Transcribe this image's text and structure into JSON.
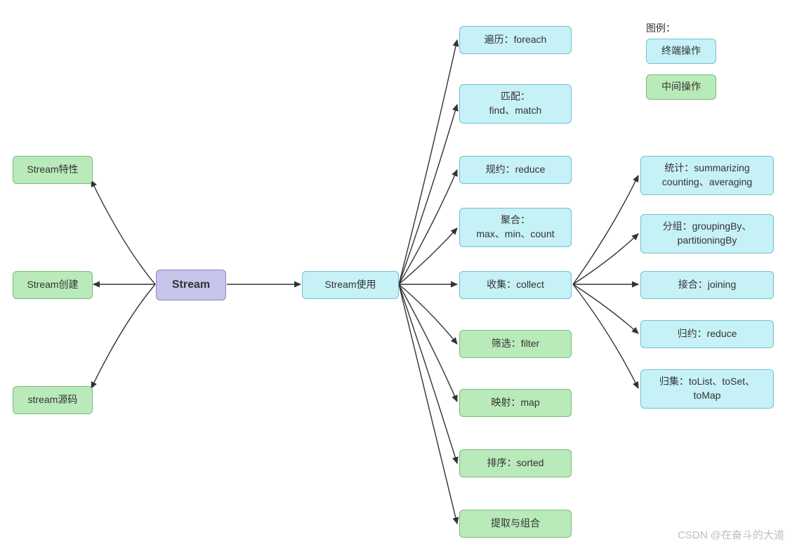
{
  "nodes": {
    "stream_properties": "Stream特性",
    "stream_create": "Stream创建",
    "stream_source": "stream源码",
    "stream_root": "Stream",
    "stream_usage": "Stream使用",
    "foreach": "遍历：foreach",
    "match": "匹配：\nfind、match",
    "reduce": "规约：reduce",
    "aggregate": "聚合：\nmax、min、count",
    "collect": "收集：collect",
    "filter": "筛选：filter",
    "map": "映射：map",
    "sorted": "排序：sorted",
    "extract": "提取与组合",
    "summarizing": "统计：summarizing\ncounting、averaging",
    "grouping": "分组：groupingBy、\npartitioningBy",
    "joining": "接合：joining",
    "reduce2": "归约：reduce",
    "tolist": "归集：toList、toSet、\ntoMap"
  },
  "legend": {
    "title": "图例：",
    "terminal": "终端操作",
    "intermediate": "中间操作"
  },
  "watermark": "CSDN @在奋斗的大道"
}
